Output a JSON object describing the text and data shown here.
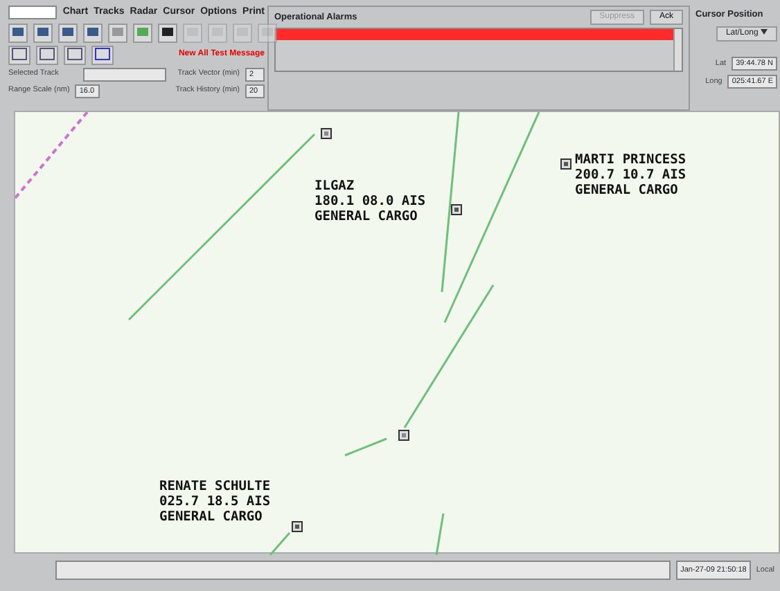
{
  "menu": [
    "Chart",
    "Tracks",
    "Radar",
    "Cursor",
    "Options",
    "Print"
  ],
  "message": "New All Test Message",
  "fields": [
    {
      "label": "Selected Track"
    },
    {
      "label": "Track Vector (min)",
      "value": "2"
    },
    {
      "label": "Range Scale (nm)",
      "value": "16.0"
    },
    {
      "label": "Track History (min)",
      "value": "20"
    }
  ],
  "alarms": {
    "title": "Operational Alarms",
    "buttons": [
      {
        "label": "Suppress",
        "disabled": true
      },
      {
        "label": "Ack",
        "disabled": false
      }
    ],
    "active": true
  },
  "cursor_position": {
    "title": "Cursor Position",
    "format": "Lat/Long",
    "lat_label": "Lat",
    "lat": "39:44.78 N",
    "long_label": "Long",
    "long": "025:41.67 E"
  },
  "targets": [
    {
      "kind": "unlabeled"
    },
    {
      "lines": [
        "ILGAZ",
        "180.1 08.0 AIS",
        "GENERAL CARGO"
      ]
    },
    {
      "lines": [
        "MARTI PRINCESS",
        "200.7 10.7 AIS",
        "GENERAL CARGO"
      ]
    },
    {
      "kind": "unlabeled"
    },
    {
      "lines": [
        "RENATE SCHULTE",
        "025.7 18.5 AIS",
        "GENERAL CARGO"
      ]
    }
  ],
  "status_bar": {
    "time": "Jan-27-09 21:50:18",
    "zone": "Local"
  }
}
